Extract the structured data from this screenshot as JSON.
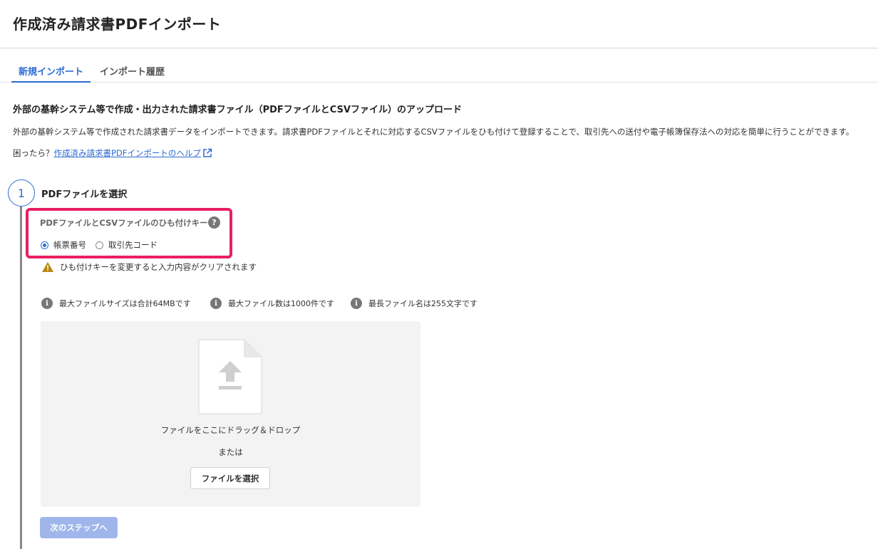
{
  "header": {
    "title": "作成済み請求書PDFインポート"
  },
  "tabs": [
    {
      "label": "新規インポート",
      "active": true
    },
    {
      "label": "インポート履歴",
      "active": false
    }
  ],
  "intro": {
    "heading": "外部の基幹システム等で作成・出力された請求書ファイル（PDFファイルとCSVファイル）のアップロード",
    "description": "外部の基幹システム等で作成された請求書データをインポートできます。請求書PDFファイルとそれに対応するCSVファイルをひも付けて登録することで、取引先への送付や電子帳簿保存法への対応を簡単に行うことができます。",
    "help_prefix": "困ったら？",
    "help_link": "作成済み請求書PDFインポートのヘルプ"
  },
  "step": {
    "number": "1",
    "title": "PDFファイルを選択",
    "key_label": "PDFファイルとCSVファイルのひも付けキー",
    "help_icon": "?",
    "options": [
      {
        "label": "帳票番号",
        "selected": true
      },
      {
        "label": "取引先コード",
        "selected": false
      }
    ],
    "warning": "ひも付けキーを変更すると入力内容がクリアされます",
    "info": [
      "最大ファイルサイズは合計64MBです",
      "最大ファイル数は1000件です",
      "最長ファイル名は255文字です"
    ],
    "dropzone": {
      "drag_text": "ファイルをここにドラッグ＆ドロップ",
      "or_text": "または",
      "select_button": "ファイルを選択"
    },
    "next_button": "次のステップへ"
  },
  "colors": {
    "accent": "#2d6bd3",
    "highlight": "#ea1f62",
    "warning": "#b7870f",
    "disabled_button": "#9fb6ea"
  }
}
